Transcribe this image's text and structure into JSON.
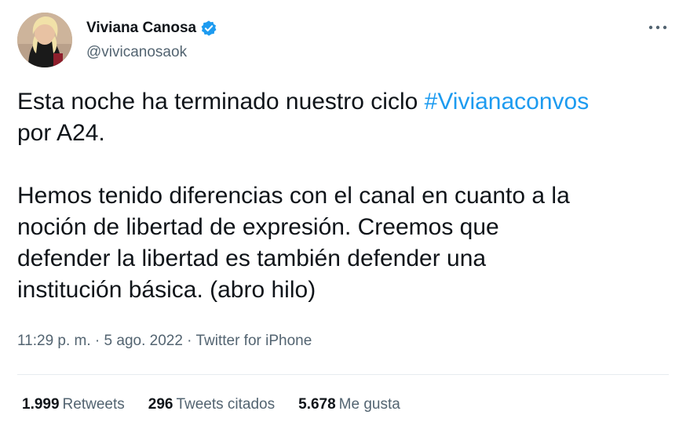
{
  "tweet": {
    "author": {
      "display_name": "Viviana Canosa",
      "handle": "@vivicanosaok",
      "verified": true,
      "avatar_icon": "profile-photo"
    },
    "more_icon": "more-horizontal-icon",
    "text": {
      "line1_before": "Esta noche ha terminado nuestro ciclo ",
      "hashtag": "#Vivianaconvos",
      "line1_after": "\npor A24.\n\nHemos tenido diferencias con el canal en cuanto a la\nnoción de libertad de expresión. Creemos que\ndefender la libertad es también defender una\ninstitución básica. (abro hilo)"
    },
    "meta": "11:29 p. m. · 5 ago. 2022 · Twitter for iPhone",
    "stats": [
      {
        "count": "1.999",
        "label": "Retweets"
      },
      {
        "count": "296",
        "label": "Tweets citados"
      },
      {
        "count": "5.678",
        "label": "Me gusta"
      }
    ]
  },
  "colors": {
    "link": "#1d9bf0",
    "secondary_text": "#536471",
    "primary_text": "#0f1419",
    "divider": "#e6ecf0"
  }
}
